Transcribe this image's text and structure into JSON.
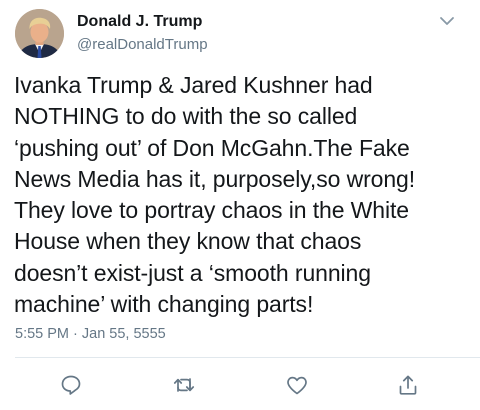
{
  "user": {
    "display_name": "Donald J. Trump",
    "handle": "@realDonaldTrump",
    "avatar_icon": "profile-photo"
  },
  "tweet": {
    "text": "Ivanka Trump & Jared Kushner had\nNOTHING to do with the so called\n‘pushing out’ of Don McGahn.The Fake\nNews Media has it, purposely,so wrong!\nThey love to portray chaos in the White\nHouse when they know that chaos\ndoesn’t exist-just a ‘smooth running\nmachine’ with changing parts!",
    "timestamp": "5:55 PM · Jan 55, 5555"
  },
  "actions": {
    "reply_icon": "reply-icon",
    "retweet_icon": "retweet-icon",
    "like_icon": "heart-icon",
    "share_icon": "share-icon"
  },
  "colors": {
    "primary_text": "#14171a",
    "secondary_text": "#657786",
    "divider": "#e1e8ed"
  }
}
